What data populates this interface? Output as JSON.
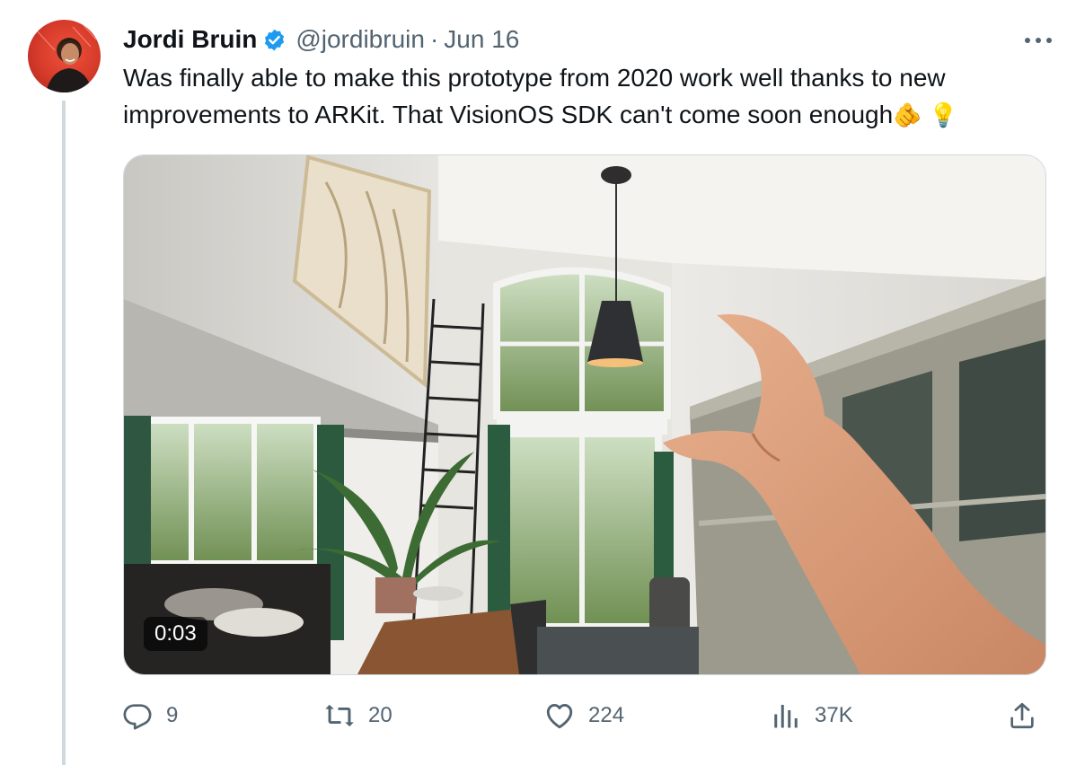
{
  "tweet": {
    "author_name": "Jordi Bruin",
    "handle": "@jordibruin",
    "separator": "·",
    "date": "Jun 16",
    "text_line1": "Was finally able to make this prototype from 2020 work well thanks to new",
    "text_line2": "improvements to ARKit. That VisionOS SDK can't come soon enough",
    "emoji_1": "🫵",
    "emoji_2": "💡",
    "video_time": "0:03"
  },
  "actions": {
    "replies": "9",
    "reposts": "20",
    "likes": "224",
    "views": "37K"
  },
  "icons": {
    "verified": "verified-badge-icon",
    "more": "more-icon",
    "reply": "reply-icon",
    "repost": "repost-icon",
    "like": "heart-icon",
    "views": "views-icon",
    "share": "share-icon"
  },
  "colors": {
    "text": "#0f1419",
    "secondary": "#536471",
    "verified": "#1d9bf0",
    "thread_line": "#cfd9de"
  }
}
